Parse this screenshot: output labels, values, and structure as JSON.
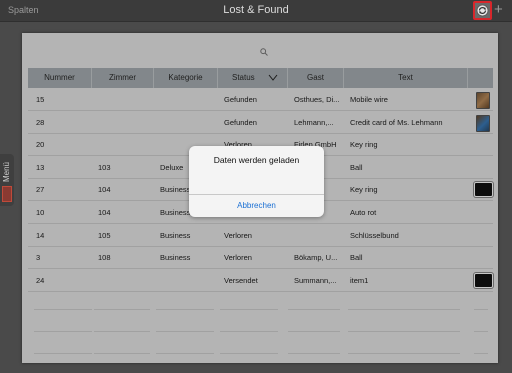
{
  "topbar": {
    "left_label": "Spalten",
    "title": "Lost & Found",
    "sync_icon": "sync-icon",
    "add_icon": "plus-icon",
    "add_label": "+"
  },
  "side_menu": {
    "label": "Menü",
    "icon": "menu-thumbnail-icon"
  },
  "search": {
    "icon": "search-icon"
  },
  "table": {
    "columns": [
      "Nummer",
      "Zimmer",
      "Kategorie",
      "Status",
      "Gast",
      "Text"
    ],
    "sort_icon": "sort-chevron-icon",
    "rows": [
      {
        "nummer": "15",
        "zimmer": "",
        "kategorie": "",
        "status": "Gefunden",
        "gast": "Osthues, Di...",
        "text": "Mobile wire",
        "thumb": "wire-photo"
      },
      {
        "nummer": "28",
        "zimmer": "",
        "kategorie": "",
        "status": "Gefunden",
        "gast": "Lehmann,...",
        "text": "Credit card of Ms. Lehmann",
        "thumb": "card-photo"
      },
      {
        "nummer": "20",
        "zimmer": "",
        "kategorie": "",
        "status": "Verloren",
        "gast": "Firlen GmbH",
        "text": "Key ring",
        "thumb": ""
      },
      {
        "nummer": "13",
        "zimmer": "103",
        "kategorie": "Deluxe",
        "status": "",
        "gast": "",
        "text": "Ball",
        "thumb": ""
      },
      {
        "nummer": "27",
        "zimmer": "104",
        "kategorie": "Business",
        "status": "",
        "gast": "",
        "text": "Key ring",
        "thumb": "black"
      },
      {
        "nummer": "10",
        "zimmer": "104",
        "kategorie": "Business",
        "status": "",
        "gast": "",
        "text": "Auto rot",
        "thumb": ""
      },
      {
        "nummer": "14",
        "zimmer": "105",
        "kategorie": "Business",
        "status": "Verloren",
        "gast": "",
        "text": "Schlüsselbund",
        "thumb": ""
      },
      {
        "nummer": "3",
        "zimmer": "108",
        "kategorie": "Business",
        "status": "Verloren",
        "gast": "Bökamp, U...",
        "text": "Ball",
        "thumb": ""
      },
      {
        "nummer": "24",
        "zimmer": "",
        "kategorie": "",
        "status": "Versendet",
        "gast": "Summann,...",
        "text": "item1",
        "thumb": "black"
      }
    ]
  },
  "dialog": {
    "message": "Daten werden geladen",
    "cancel_label": "Abbrechen"
  },
  "colors": {
    "header_bg": "#a7aeb2",
    "accent": "#1a6fd3",
    "highlight_border": "#d8262b"
  }
}
